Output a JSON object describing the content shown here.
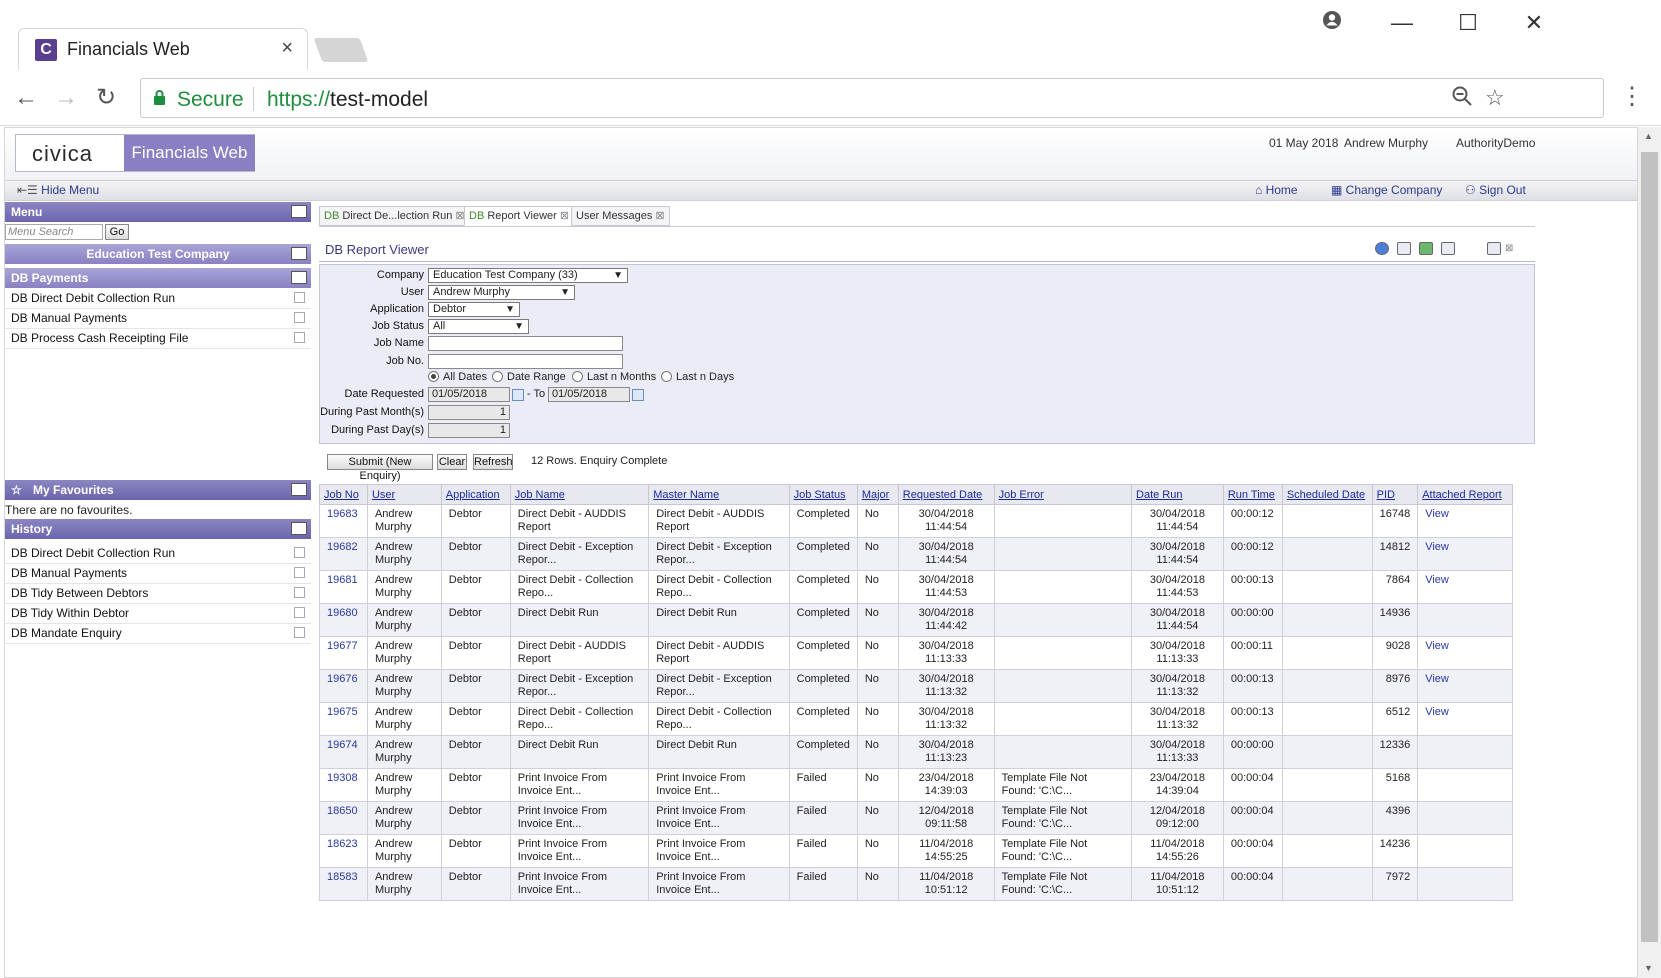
{
  "browser": {
    "tab_title": "Financials Web",
    "tab_close": "×",
    "favicon": "C",
    "secure_label": "Secure",
    "url_scheme": "https://",
    "url_host": "test-model"
  },
  "header": {
    "logo_civica": "civica",
    "logo_product": "Financials Web",
    "date": "01 May 2018",
    "user": "Andrew Murphy",
    "authority": "AuthorityDemo"
  },
  "menubar": {
    "hide_menu": "Hide Menu",
    "home": "Home",
    "change_company": "Change Company",
    "sign_out": "Sign Out"
  },
  "left": {
    "menu_title": "Menu",
    "search_placeholder": "Menu Search",
    "go": "Go",
    "company": "Education Test Company",
    "section": "DB Payments",
    "items": [
      "DB Direct Debit Collection Run",
      "DB Manual Payments",
      "DB Process Cash Receipting File"
    ],
    "favourites_title": "My Favourites",
    "favourites_empty": "There are no favourites.",
    "history_title": "History",
    "history": [
      "DB Direct Debit Collection Run",
      "DB Manual Payments",
      "DB Tidy Between Debtors",
      "DB Tidy Within Debtor",
      "DB Mandate Enquiry"
    ]
  },
  "tabs": [
    {
      "prefix": "DB",
      "label": "Direct De...lection Run"
    },
    {
      "prefix": "DB",
      "label": "Report Viewer"
    },
    {
      "prefix": "",
      "label": "User Messages"
    }
  ],
  "viewer": {
    "title": "DB Report Viewer",
    "labels": {
      "company": "Company",
      "user": "User",
      "application": "Application",
      "job_status": "Job Status",
      "job_name": "Job Name",
      "job_no": "Job No.",
      "date_requested": "Date Requested",
      "to": "- To",
      "past_months": "During Past Month(s)",
      "past_days": "During Past Day(s)"
    },
    "values": {
      "company": "Education Test Company (33)",
      "user": "Andrew Murphy",
      "application": "Debtor",
      "job_status": "All",
      "job_name": "",
      "job_no": "",
      "date_from": "01/05/2018",
      "date_to": "01/05/2018",
      "past_months": "1",
      "past_days": "1"
    },
    "radios": [
      "All Dates",
      "Date Range",
      "Last n Months",
      "Last n Days"
    ],
    "buttons": {
      "submit": "Submit (New Enquiry)",
      "clear": "Clear",
      "refresh": "Refresh"
    },
    "status": "12 Rows. Enquiry Complete"
  },
  "table": {
    "headers": [
      "Job No",
      "User",
      "Application",
      "Job Name",
      "Master Name",
      "Job Status",
      "Major",
      "Requested Date",
      "Job Error",
      "Date Run",
      "Run Time",
      "Scheduled Date",
      "PID",
      "Attached Report"
    ],
    "rows": [
      {
        "job_no": "19683",
        "user": "Andrew Murphy",
        "app": "Debtor",
        "job_name": "Direct Debit - AUDDIS Report",
        "master": "Direct Debit - AUDDIS Report",
        "status": "Completed",
        "major": "No",
        "req_date": "30/04/2018",
        "req_time": "11:44:54",
        "error": "",
        "run_date": "30/04/2018",
        "run_time_of": "11:44:54",
        "run_time": "00:00:12",
        "sched": "",
        "pid": "16748",
        "att": "View"
      },
      {
        "job_no": "19682",
        "user": "Andrew Murphy",
        "app": "Debtor",
        "job_name": "Direct Debit - Exception Repor...",
        "master": "Direct Debit - Exception Repor...",
        "status": "Completed",
        "major": "No",
        "req_date": "30/04/2018",
        "req_time": "11:44:54",
        "error": "",
        "run_date": "30/04/2018",
        "run_time_of": "11:44:54",
        "run_time": "00:00:12",
        "sched": "",
        "pid": "14812",
        "att": "View"
      },
      {
        "job_no": "19681",
        "user": "Andrew Murphy",
        "app": "Debtor",
        "job_name": "Direct Debit - Collection Repo...",
        "master": "Direct Debit - Collection Repo...",
        "status": "Completed",
        "major": "No",
        "req_date": "30/04/2018",
        "req_time": "11:44:53",
        "error": "",
        "run_date": "30/04/2018",
        "run_time_of": "11:44:53",
        "run_time": "00:00:13",
        "sched": "",
        "pid": "7864",
        "att": "View"
      },
      {
        "job_no": "19680",
        "user": "Andrew Murphy",
        "app": "Debtor",
        "job_name": "Direct Debit Run",
        "master": "Direct Debit Run",
        "status": "Completed",
        "major": "No",
        "req_date": "30/04/2018",
        "req_time": "11:44:42",
        "error": "",
        "run_date": "30/04/2018",
        "run_time_of": "11:44:54",
        "run_time": "00:00:00",
        "sched": "",
        "pid": "14936",
        "att": ""
      },
      {
        "job_no": "19677",
        "user": "Andrew Murphy",
        "app": "Debtor",
        "job_name": "Direct Debit - AUDDIS Report",
        "master": "Direct Debit - AUDDIS Report",
        "status": "Completed",
        "major": "No",
        "req_date": "30/04/2018",
        "req_time": "11:13:33",
        "error": "",
        "run_date": "30/04/2018",
        "run_time_of": "11:13:33",
        "run_time": "00:00:11",
        "sched": "",
        "pid": "9028",
        "att": "View"
      },
      {
        "job_no": "19676",
        "user": "Andrew Murphy",
        "app": "Debtor",
        "job_name": "Direct Debit - Exception Repor...",
        "master": "Direct Debit - Exception Repor...",
        "status": "Completed",
        "major": "No",
        "req_date": "30/04/2018",
        "req_time": "11:13:32",
        "error": "",
        "run_date": "30/04/2018",
        "run_time_of": "11:13:32",
        "run_time": "00:00:13",
        "sched": "",
        "pid": "8976",
        "att": "View"
      },
      {
        "job_no": "19675",
        "user": "Andrew Murphy",
        "app": "Debtor",
        "job_name": "Direct Debit - Collection Repo...",
        "master": "Direct Debit - Collection Repo...",
        "status": "Completed",
        "major": "No",
        "req_date": "30/04/2018",
        "req_time": "11:13:32",
        "error": "",
        "run_date": "30/04/2018",
        "run_time_of": "11:13:32",
        "run_time": "00:00:13",
        "sched": "",
        "pid": "6512",
        "att": "View"
      },
      {
        "job_no": "19674",
        "user": "Andrew Murphy",
        "app": "Debtor",
        "job_name": "Direct Debit Run",
        "master": "Direct Debit Run",
        "status": "Completed",
        "major": "No",
        "req_date": "30/04/2018",
        "req_time": "11:13:23",
        "error": "",
        "run_date": "30/04/2018",
        "run_time_of": "11:13:33",
        "run_time": "00:00:00",
        "sched": "",
        "pid": "12336",
        "att": ""
      },
      {
        "job_no": "19308",
        "user": "Andrew Murphy",
        "app": "Debtor",
        "job_name": "Print Invoice From Invoice Ent...",
        "master": "Print Invoice From Invoice Ent...",
        "status": "Failed",
        "major": "No",
        "req_date": "23/04/2018",
        "req_time": "14:39:03",
        "error": "Template File Not Found: 'C:\\C...",
        "run_date": "23/04/2018",
        "run_time_of": "14:39:04",
        "run_time": "00:00:04",
        "sched": "",
        "pid": "5168",
        "att": ""
      },
      {
        "job_no": "18650",
        "user": "Andrew Murphy",
        "app": "Debtor",
        "job_name": "Print Invoice From Invoice Ent...",
        "master": "Print Invoice From Invoice Ent...",
        "status": "Failed",
        "major": "No",
        "req_date": "12/04/2018",
        "req_time": "09:11:58",
        "error": "Template File Not Found: 'C:\\C...",
        "run_date": "12/04/2018",
        "run_time_of": "09:12:00",
        "run_time": "00:00:04",
        "sched": "",
        "pid": "4396",
        "att": ""
      },
      {
        "job_no": "18623",
        "user": "Andrew Murphy",
        "app": "Debtor",
        "job_name": "Print Invoice From Invoice Ent...",
        "master": "Print Invoice From Invoice Ent...",
        "status": "Failed",
        "major": "No",
        "req_date": "11/04/2018",
        "req_time": "14:55:25",
        "error": "Template File Not Found: 'C:\\C...",
        "run_date": "11/04/2018",
        "run_time_of": "14:55:26",
        "run_time": "00:00:04",
        "sched": "",
        "pid": "14236",
        "att": ""
      },
      {
        "job_no": "18583",
        "user": "Andrew Murphy",
        "app": "Debtor",
        "job_name": "Print Invoice From Invoice Ent...",
        "master": "Print Invoice From Invoice Ent...",
        "status": "Failed",
        "major": "No",
        "req_date": "11/04/2018",
        "req_time": "10:51:12",
        "error": "Template File Not Found: 'C:\\C...",
        "run_date": "11/04/2018",
        "run_time_of": "10:51:12",
        "run_time": "00:00:04",
        "sched": "",
        "pid": "7972",
        "att": ""
      }
    ]
  }
}
